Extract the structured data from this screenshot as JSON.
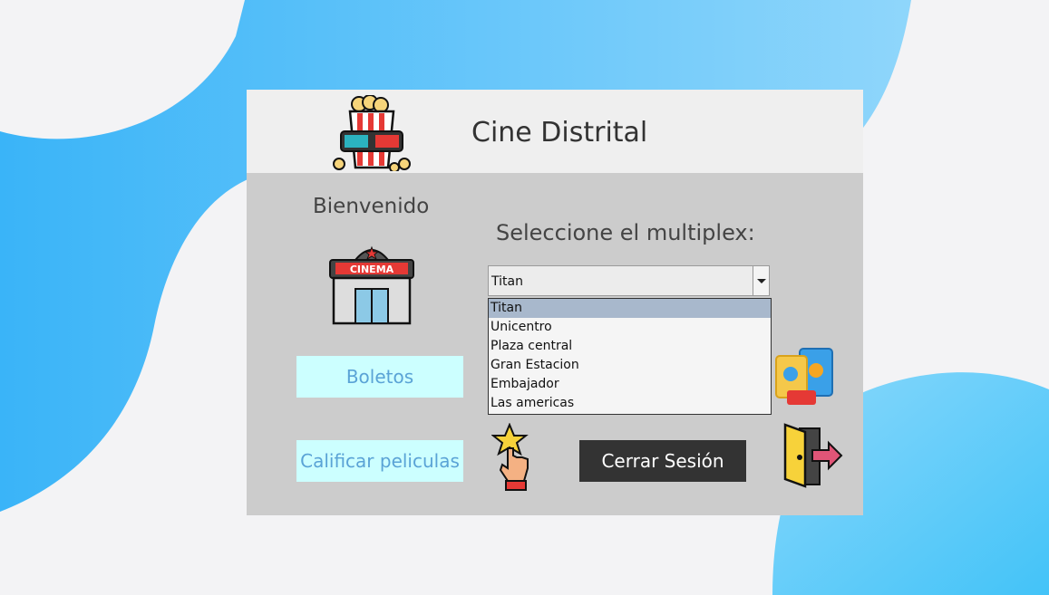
{
  "window": {
    "title": "Cine Distrital"
  },
  "main": {
    "welcome": "Bienvenido",
    "select_label": "Seleccione el multiplex:",
    "multiplex_select": {
      "value": "Titan",
      "options": [
        "Titan",
        "Unicentro",
        "Plaza central",
        "Gran Estacion",
        "Embajador",
        "Las americas"
      ],
      "highlighted_index": 0
    },
    "buttons": {
      "boletos": "Boletos",
      "calificar": "Calificar peliculas",
      "cerrar": "Cerrar Sesión"
    }
  },
  "icons": {
    "header": "popcorn-3d-glasses-icon",
    "cinema": "cinema-building-icon",
    "snacks": "snacks-icon",
    "rating": "hand-star-icon",
    "logout": "exit-door-icon"
  },
  "colors": {
    "panel_bg": "#cccccc",
    "header_bg": "#efefef",
    "light_button_bg": "#ccffff",
    "light_button_text": "#5aa3d6",
    "dark_button_bg": "#333333",
    "blob_blue": "#45b6f7"
  }
}
